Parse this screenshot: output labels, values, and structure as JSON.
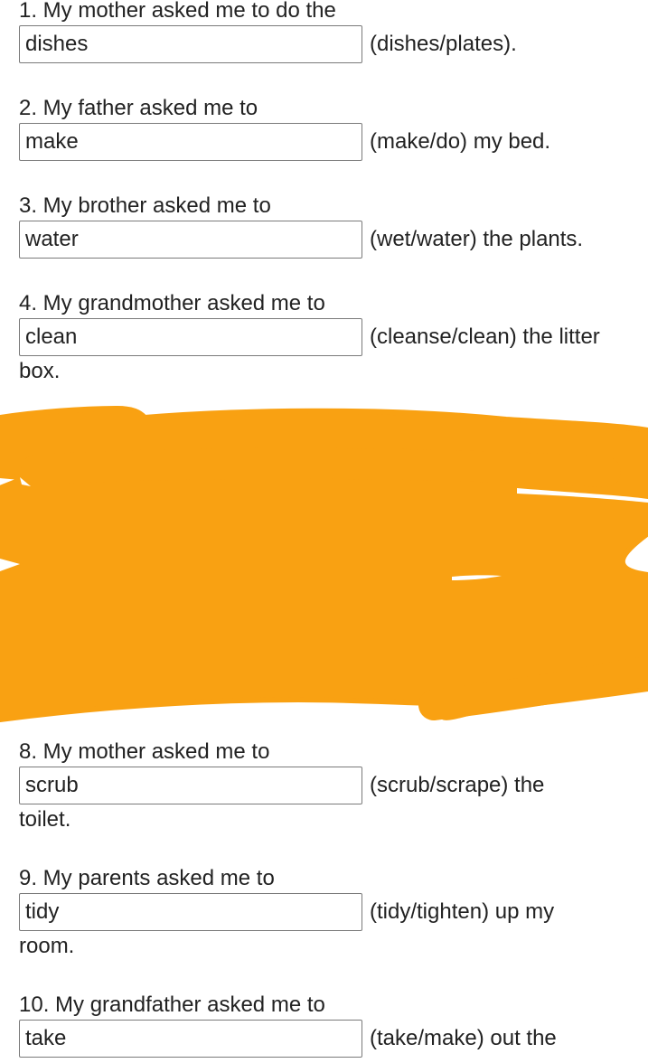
{
  "questions": [
    {
      "prefix": "1. My mother asked me to do the",
      "answer": "dishes",
      "suffix": "(dishes/plates).",
      "continuation": ""
    },
    {
      "prefix": "2. My father asked me to",
      "answer": "make",
      "suffix": "(make/do) my bed.",
      "continuation": ""
    },
    {
      "prefix": "3. My brother asked me to",
      "answer": "water",
      "suffix": "(wet/water) the plants.",
      "continuation": ""
    },
    {
      "prefix": "4. My grandmother asked me to",
      "answer": "clean",
      "suffix": "(cleanse/clean) the litter",
      "continuation": "box."
    },
    {
      "prefix": "8. My mother asked me to",
      "answer": "scrub",
      "suffix": "(scrub/scrape) the",
      "continuation": "toilet."
    },
    {
      "prefix": "9. My parents asked me to",
      "answer": "tidy",
      "suffix": "(tidy/tighten) up my",
      "continuation": "room."
    },
    {
      "prefix": "10. My grandfather asked me to",
      "answer": "take",
      "suffix": "(take/make) out the",
      "continuation": ""
    }
  ],
  "colors": {
    "redaction": "#F9A112",
    "text": "#222222",
    "input_border": "#7a7a7a"
  }
}
